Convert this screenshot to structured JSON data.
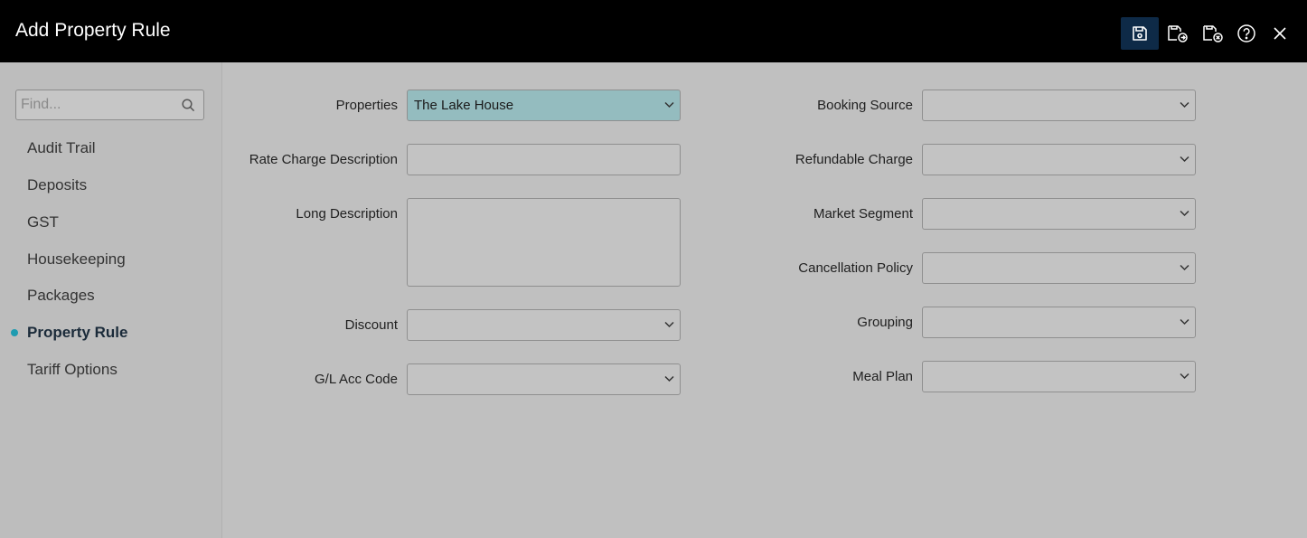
{
  "header": {
    "title": "Add Property Rule",
    "icons": [
      "save-icon",
      "save-and-close-icon",
      "cancel-changes-icon",
      "help-icon",
      "close-icon"
    ]
  },
  "sidebar": {
    "search_placeholder": "Find...",
    "items": [
      {
        "label": "Audit Trail"
      },
      {
        "label": "Deposits"
      },
      {
        "label": "GST"
      },
      {
        "label": "Housekeeping"
      },
      {
        "label": "Packages"
      },
      {
        "label": "Property Rule"
      },
      {
        "label": "Tariff Options"
      }
    ],
    "active_index": 5
  },
  "form": {
    "left": {
      "properties": {
        "label": "Properties",
        "value": "The Lake House"
      },
      "rate_charge_description": {
        "label": "Rate Charge Description",
        "value": ""
      },
      "long_description": {
        "label": "Long Description",
        "value": ""
      },
      "discount": {
        "label": "Discount",
        "value": ""
      },
      "gl_acc_code": {
        "label": "G/L Acc Code",
        "value": ""
      }
    },
    "right": {
      "booking_source": {
        "label": "Booking Source",
        "value": ""
      },
      "refundable_charge": {
        "label": "Refundable Charge",
        "value": ""
      },
      "market_segment": {
        "label": "Market Segment",
        "value": ""
      },
      "cancellation_policy": {
        "label": "Cancellation Policy",
        "value": ""
      },
      "grouping": {
        "label": "Grouping",
        "value": ""
      },
      "meal_plan": {
        "label": "Meal Plan",
        "value": ""
      }
    }
  },
  "colors": {
    "header_bg": "#000000",
    "active_tool_bg": "#0e2a47",
    "active_dot": "#1e9bb0",
    "highlight_field": "#94bcbf"
  }
}
